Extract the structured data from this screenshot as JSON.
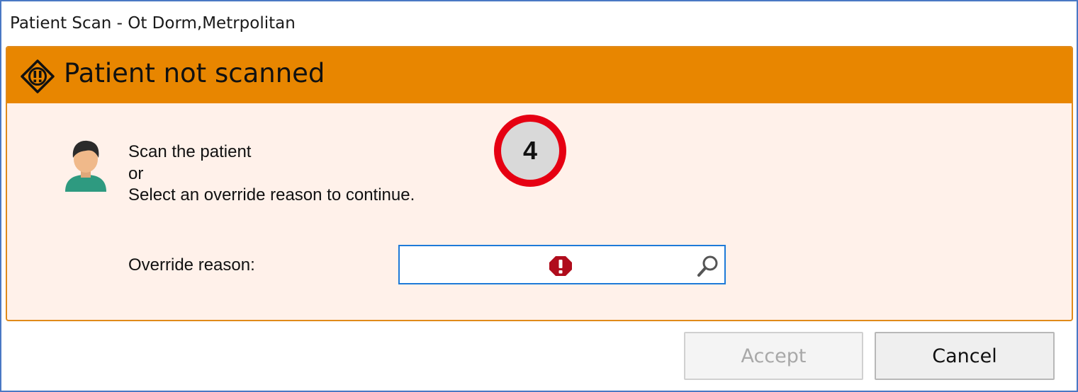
{
  "window": {
    "title": "Patient Scan - Ot Dorm,Metrpolitan"
  },
  "alert": {
    "title": "Patient not scanned",
    "icon": "warning-diamond-icon",
    "header_color": "#e88600",
    "panel_color": "#fff1ea"
  },
  "instructions": {
    "line1": "Scan the patient",
    "line2": "or",
    "line3": "Select an override reason to continue."
  },
  "step_badge": {
    "number": "4",
    "ring_color": "#e60012"
  },
  "override": {
    "label": "Override reason:",
    "value": "",
    "error_icon": "error-icon",
    "search_icon": "search-icon"
  },
  "buttons": {
    "accept_label": "Accept",
    "accept_enabled": false,
    "cancel_label": "Cancel"
  }
}
